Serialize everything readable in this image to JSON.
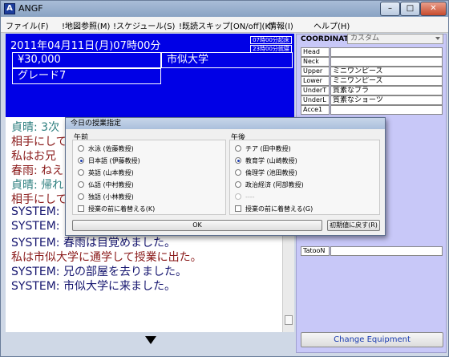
{
  "window": {
    "title": "ANGF"
  },
  "menu": [
    "ファイル(F)",
    "!地図参照(M)",
    "!スケジュール(S)",
    "!既読スキップ[ON/off](K)",
    "情報(I)",
    "ヘルプ(H)"
  ],
  "status": {
    "datetime": "2011年04月11日(月)07時00分",
    "btn_wake": "07時00分起床",
    "btn_sleep": "23時00分就寝",
    "money": "¥30,000",
    "grade": "グレード7",
    "location": "市似大学"
  },
  "log": [
    {
      "text": "貞晴: 3次",
      "color": "#2e7f7f"
    },
    {
      "text": "相手にして",
      "color": "#8a1a1a"
    },
    {
      "text": "私はお兄",
      "color": "#8a1a1a"
    },
    {
      "text": "春雨: ねえ",
      "color": "#8a1a1a"
    },
    {
      "text": "貞晴: 帰れ",
      "color": "#2e7f7f"
    },
    {
      "text": "相手にして",
      "color": "#8a1a1a"
    },
    {
      "text": "SYSTEM: ",
      "color": "#14146e"
    },
    {
      "text": "SYSTEM: ",
      "color": "#14146e"
    },
    {
      "text": "SYSTEM: 春雨は目覚めました。",
      "color": "#14146e"
    },
    {
      "text": "私は市似大学に通学して授業に出た。",
      "color": "#8a1a1a"
    },
    {
      "text": "SYSTEM: 兄の部屋を去りました。",
      "color": "#14146e"
    },
    {
      "text": "SYSTEM: 市似大学に来ました。",
      "color": "#14146e"
    }
  ],
  "coordinate": {
    "label": "COORDINATE:",
    "value": "カスタム"
  },
  "equipment": [
    {
      "name": "Head",
      "value": ""
    },
    {
      "name": "Neck",
      "value": ""
    },
    {
      "name": "Upper",
      "value": "ミニワンピース"
    },
    {
      "name": "Lower",
      "value": "ミニワンピース"
    },
    {
      "name": "UnderT",
      "value": "質素なブラ"
    },
    {
      "name": "UnderL",
      "value": "質素なショーツ"
    },
    {
      "name": "Acce1",
      "value": ""
    },
    {
      "name": "TatooN",
      "value": ""
    }
  ],
  "change_button": "Change Equipment",
  "dialog": {
    "title": "今日の授業指定",
    "morning": {
      "label": "午前",
      "options": [
        {
          "label": "水泳 (佐藤教授)",
          "checked": false,
          "disabled": false
        },
        {
          "label": "日本語 (伊藤教授)",
          "checked": true,
          "disabled": false
        },
        {
          "label": "英語 (山本教授)",
          "checked": false,
          "disabled": false
        },
        {
          "label": "仏語 (中村教授)",
          "checked": false,
          "disabled": false
        },
        {
          "label": "独語 (小林教授)",
          "checked": false,
          "disabled": false
        }
      ],
      "checkbox": "授業の前に着替える(K)"
    },
    "afternoon": {
      "label": "午後",
      "options": [
        {
          "label": "チア (田中教授)",
          "checked": false,
          "disabled": false
        },
        {
          "label": "教育学 (山崎教授)",
          "checked": true,
          "disabled": false
        },
        {
          "label": "倫理学 (池田教授)",
          "checked": false,
          "disabled": false
        },
        {
          "label": "政治経済 (阿部教授)",
          "checked": false,
          "disabled": false
        },
        {
          "label": "----",
          "checked": false,
          "disabled": true
        }
      ],
      "checkbox": "授業の前に着替える(G)"
    },
    "ok_button": "OK",
    "reset_button": "初期値に戻す(R)"
  }
}
